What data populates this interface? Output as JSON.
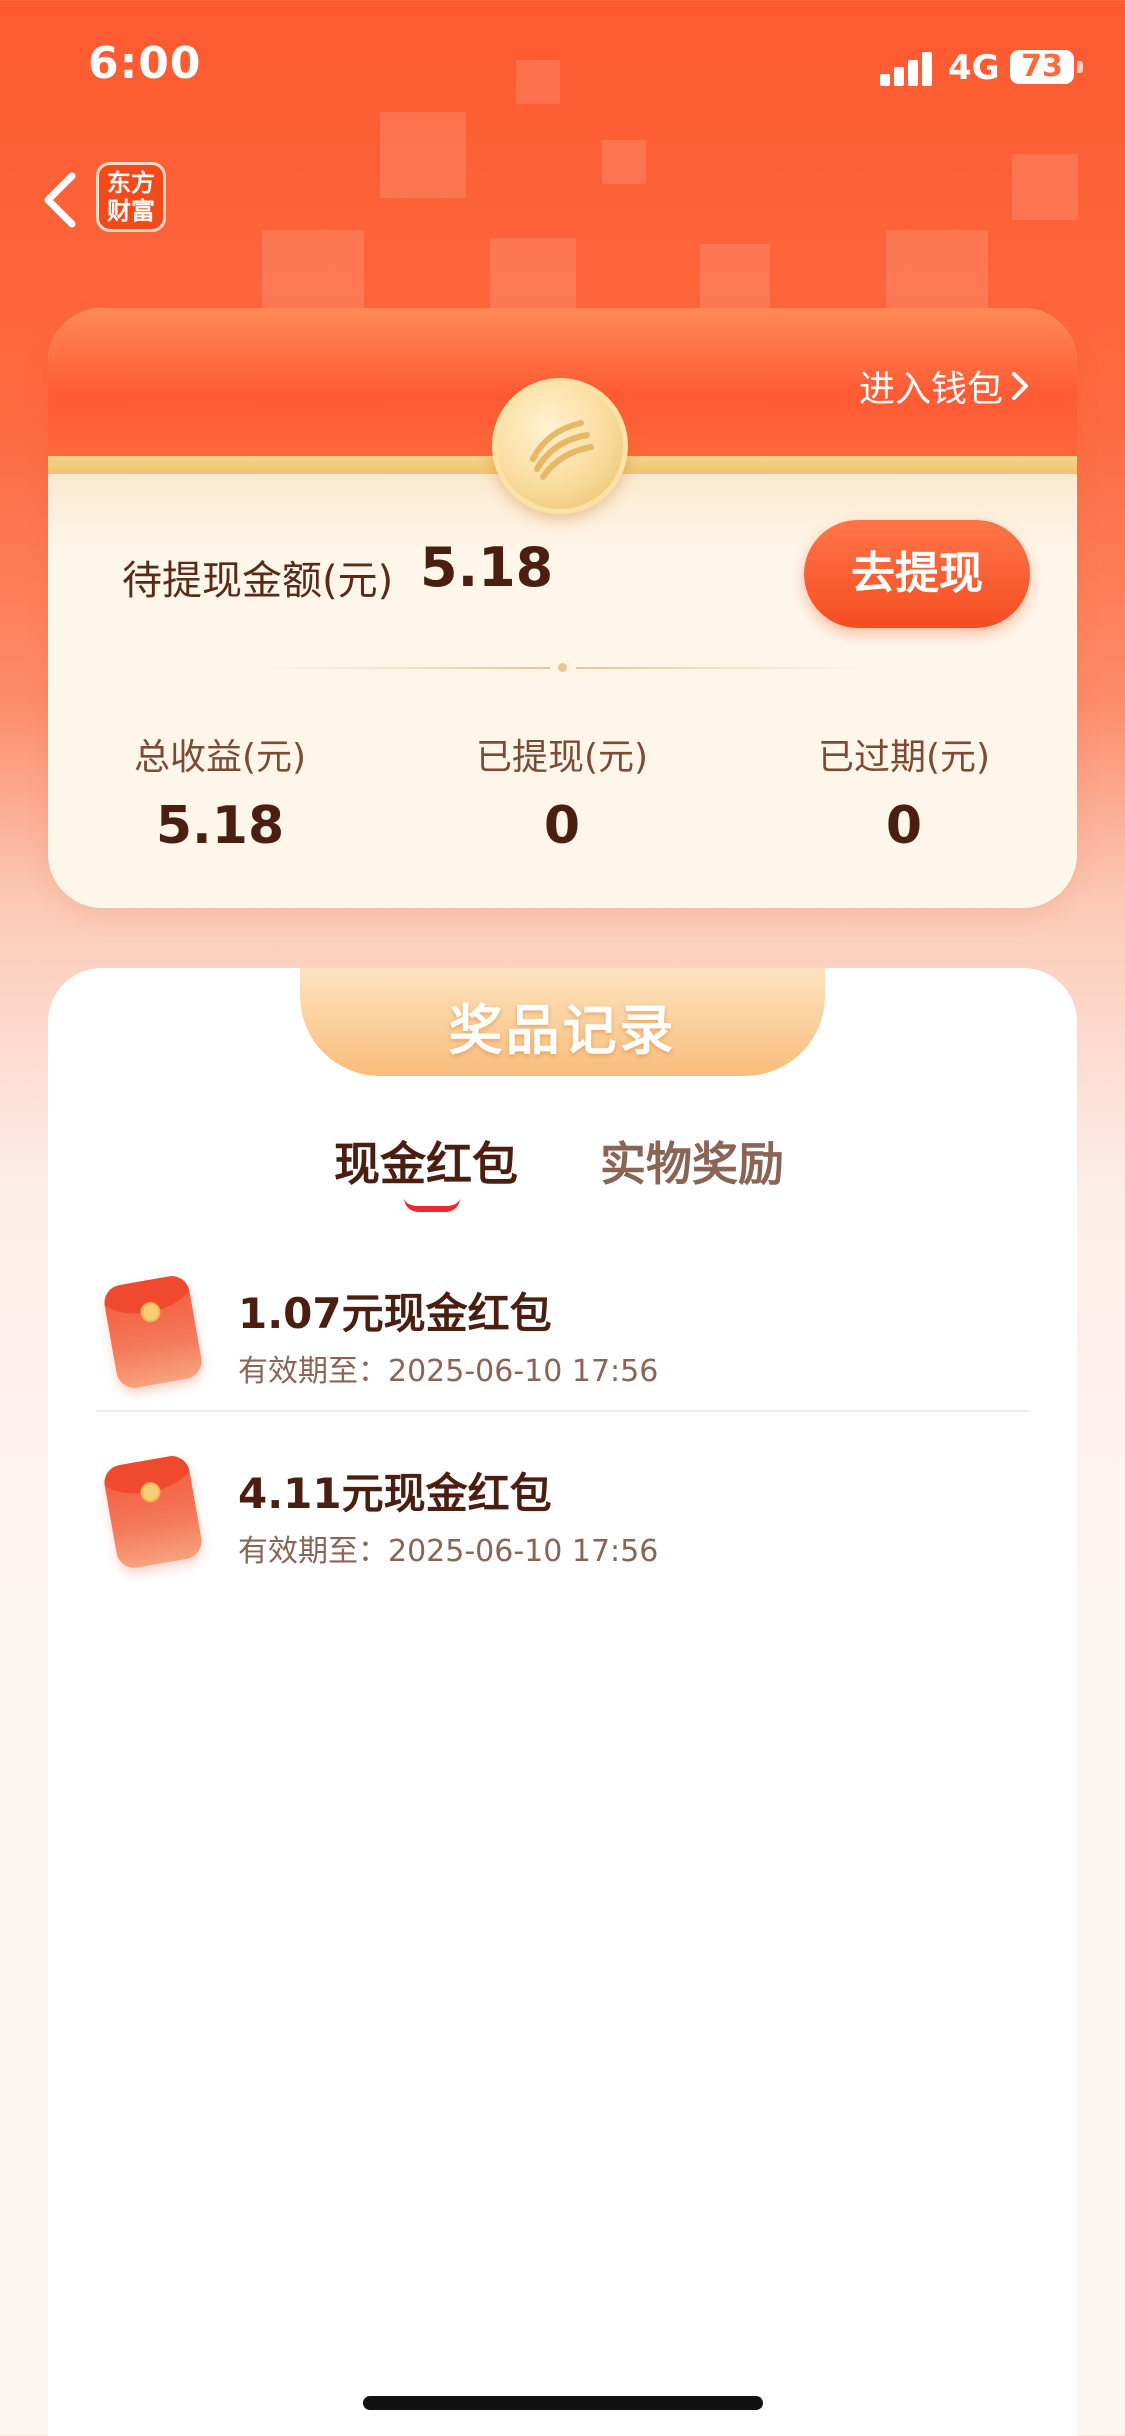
{
  "status_bar": {
    "time": "6:00",
    "network": "4G",
    "battery": "73"
  },
  "nav": {
    "logo_line1": "东方",
    "logo_line2": "财富"
  },
  "wallet": {
    "enter_wallet_label": "进入钱包",
    "pending_label": "待提现金额(元)",
    "pending_value": "5.18",
    "withdraw_button": "去提现",
    "stats": [
      {
        "label": "总收益(元)",
        "value": "5.18"
      },
      {
        "label": "已提现(元)",
        "value": "0"
      },
      {
        "label": "已过期(元)",
        "value": "0"
      }
    ]
  },
  "records": {
    "title": "奖品记录",
    "tabs": [
      {
        "label": "现金红包",
        "active": true
      },
      {
        "label": "实物奖励",
        "active": false
      }
    ],
    "items": [
      {
        "title": "1.07元现金红包",
        "expiry": "有效期至：2025-06-10 17:56"
      },
      {
        "title": "4.11元现金红包",
        "expiry": "有效期至：2025-06-10 17:56"
      }
    ]
  },
  "colors": {
    "brand_orange": "#fd5a30",
    "button_orange": "#f54d22",
    "dark_text": "#4a1f12",
    "tab_underline": "#f0272f"
  }
}
